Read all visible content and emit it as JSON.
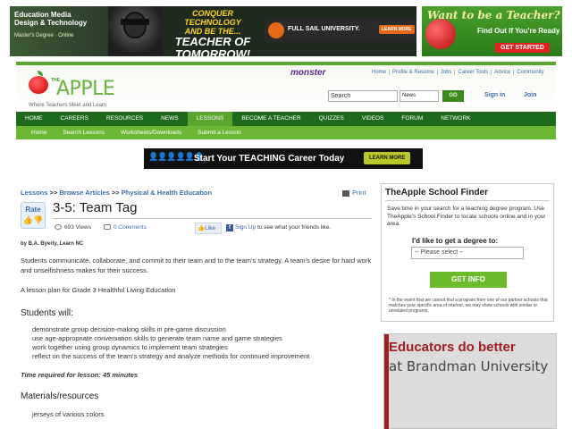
{
  "ads": {
    "top": {
      "left_line1": "Education Media",
      "left_line2": "Design & Technology",
      "left_line3": "Master's Degree · Online",
      "slogan1": "CONQUER TECHNOLOGY",
      "slogan2": "AND BE THE...",
      "slogan3": "TEACHER OF",
      "slogan4": "TOMORROW!",
      "brand": "FULL SAIL UNIVERSITY.",
      "cta": "LEARN MORE"
    },
    "right": {
      "headline": "Want to be a Teacher?",
      "sub": "Find Out If You're Ready",
      "cta": "GET STARTED"
    },
    "banner": {
      "text": "Start Your TEACHING Career Today",
      "cta": "LEARN MORE",
      "figures": "👤👤👤👤👤👤"
    },
    "brandman": {
      "line1": "Educators do better",
      "line2": "at Brandman University"
    }
  },
  "header": {
    "logo_the": "THE",
    "logo_name": "APPLE",
    "tagline": "Where Teachers Meet and Learn",
    "partner": "monster",
    "top_links": [
      "Home",
      "Profile & Resume",
      "Jobs",
      "Career Tools",
      "Advice",
      "Community"
    ],
    "search_value": "Search",
    "search_scope": "News",
    "go_label": "GO",
    "signin": "Sign in",
    "join": "Join"
  },
  "nav": {
    "main": [
      "HOME",
      "CAREERS",
      "RESOURCES",
      "NEWS",
      "LESSONS",
      "BECOME A TEACHER",
      "QUIZZES",
      "VIDEOS",
      "FORUM",
      "NETWORK"
    ],
    "active_index": 4,
    "sub": [
      "Home",
      "Search Lessons",
      "Worksheets/Downloads",
      "Submit a Lesson"
    ]
  },
  "breadcrumb": {
    "items": [
      "Lessons",
      "Browse Articles",
      "Physical & Health Education"
    ],
    "sep": ">>"
  },
  "article": {
    "print": "Print",
    "rate": "Rate",
    "title": "3-5: Team Tag",
    "views": "693 Views",
    "comments": "0 Comments",
    "fb_like": "Like",
    "fb_signup": "Sign Up",
    "fb_text": "to see what your friends like.",
    "author": "by B.A. Byerly, Learn NC",
    "intro": "Students communicate, collaborate, and commit to their team and to the team's strategy. A team's desire for hard work and unselfishness makes for their success.",
    "plan": "A lesson plan for Grade 3 Healthful Living Education",
    "students_heading": "Students will:",
    "students_will": [
      "demonstrate group decision-making skills in pre-game discussion",
      "use age-appropriate conversation skills to generate team name and game strategies",
      "work together using group dynamics to implement team strategies",
      "reflect on the success of the team's strategy and analyze methods for continued improvement"
    ],
    "time": "Time required for lesson: 45 minutes",
    "materials_heading": "Materials/resources",
    "materials": [
      "jerseys of various colors"
    ]
  },
  "finder": {
    "title": "TheApple School Finder",
    "desc": "Save time in your search for a teaching degree program. Use TheApple's School Finder to locate schools online and in your area.",
    "label": "I'd like to get a degree to:",
    "select": "-- Please select --",
    "button": "GET INFO",
    "note": "* In the event that we cannot find a program from one of our partner schools that matches your specific area of interest, we may show schools with similar or unrelated programs."
  }
}
